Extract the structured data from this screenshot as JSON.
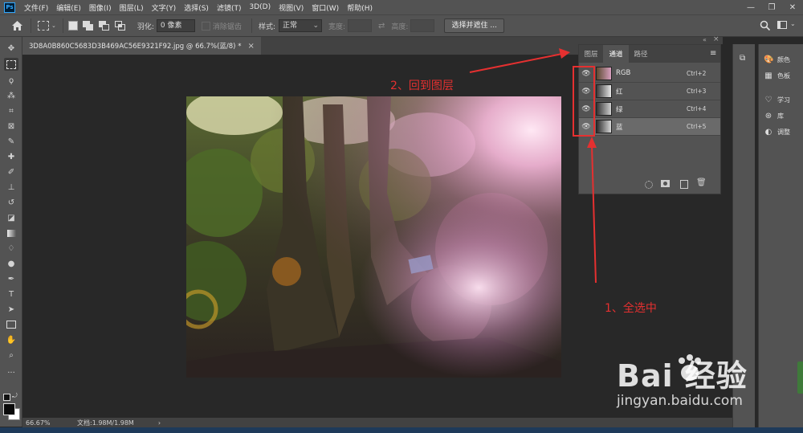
{
  "menubar": {
    "logo": "Ps",
    "items": [
      "文件(F)",
      "编辑(E)",
      "图像(I)",
      "图层(L)",
      "文字(Y)",
      "选择(S)",
      "滤镜(T)",
      "3D(D)",
      "视图(V)",
      "窗口(W)",
      "帮助(H)"
    ],
    "minimize": "—",
    "restore": "❐",
    "close": "✕"
  },
  "options": {
    "feather_label": "羽化:",
    "feather_value": "0 像素",
    "antialias_label": "消除锯齿",
    "style_label": "样式:",
    "style_value": "正常",
    "width_label": "宽度:",
    "height_label": "高度:",
    "select_mask_button": "选择并遮住 ..."
  },
  "document": {
    "tab_title": "3D8A0B860C5683D3B469AC56E9321F92.jpg @ 66.7%(蓝/8) *",
    "tab_close": "×"
  },
  "status": {
    "zoom": "66.67%",
    "doc_size": "文档:1.98M/1.98M",
    "arrow": "›"
  },
  "panel": {
    "tabs": [
      "图层",
      "通道",
      "路径"
    ],
    "active_tab": "通道",
    "menu_icon": "≡",
    "collapse": "«",
    "close": "×",
    "channels": [
      {
        "name": "RGB",
        "shortcut": "Ctrl+2",
        "selected": false
      },
      {
        "name": "红",
        "shortcut": "Ctrl+3",
        "selected": false
      },
      {
        "name": "绿",
        "shortcut": "Ctrl+4",
        "selected": false
      },
      {
        "name": "蓝",
        "shortcut": "Ctrl+5",
        "selected": true
      }
    ]
  },
  "dock": {
    "items": [
      {
        "label": "颜色",
        "icon": "palette-icon"
      },
      {
        "label": "色板",
        "icon": "swatches-icon"
      },
      {
        "label": "学习",
        "icon": "lightbulb-icon"
      },
      {
        "label": "库",
        "icon": "library-icon"
      },
      {
        "label": "调整",
        "icon": "adjustments-icon"
      }
    ]
  },
  "annotations": {
    "step1": "1、全选中",
    "step2": "2、回到图层"
  },
  "watermark": {
    "logo": "Bai  经验",
    "url": "jingyan.baidu.com"
  },
  "colors": {
    "annotation_red": "#e53030",
    "panel_bg": "#535353",
    "canvas_bg": "#282828"
  }
}
